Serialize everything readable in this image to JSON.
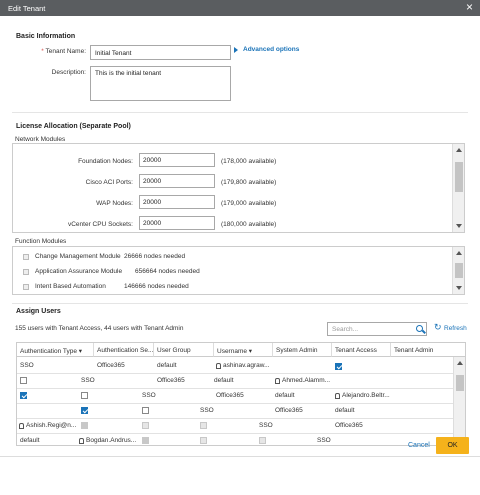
{
  "dialog": {
    "title": "Edit Tenant",
    "close_glyph": "×"
  },
  "basic": {
    "heading": "Basic Information",
    "name_label": "Tenant Name:",
    "name_required": "*",
    "name_value": "Initial Tenant",
    "advanced_link": "Advanced options",
    "desc_label": "Description:",
    "desc_value": "This is the initial tenant"
  },
  "license": {
    "heading": "License Allocation (Separate Pool)",
    "network_modules_label": "Network Modules",
    "network_modules": [
      {
        "label": "Foundation Nodes:",
        "value": "20000",
        "available": "(178,000 available)"
      },
      {
        "label": "Cisco ACI Ports:",
        "value": "20000",
        "available": "(179,800 available)"
      },
      {
        "label": "WAP Nodes:",
        "value": "20000",
        "available": "(179,000 available)"
      },
      {
        "label": "vCenter CPU Sockets:",
        "value": "20000",
        "available": "(180,000 available)"
      }
    ],
    "function_modules_label": "Function Modules",
    "function_modules": [
      {
        "name": "Change Management Module",
        "needed": "26666 nodes needed"
      },
      {
        "name": "Application Assurance Module",
        "needed": "656664 nodes needed"
      },
      {
        "name": "Intent Based Automation",
        "needed": "146666 nodes needed"
      }
    ]
  },
  "assign": {
    "heading": "Assign Users",
    "summary": "155 users with Tenant Access, 44 users with Tenant Admin",
    "search_placeholder": "Search...",
    "refresh_label": "Refresh",
    "columns": [
      "Authentication Type",
      "Authentication Se...",
      "User Group",
      "Username",
      "System Admin",
      "Tenant Access",
      "Tenant Admin"
    ],
    "sort_glyph": "▾",
    "rows": {
      "r1": {
        "auth": "SSO",
        "server": "Office365",
        "group": "default",
        "user": "ashinav.agraw..."
      },
      "r2": {
        "auth": "SSO",
        "server": "Office365",
        "group": "default",
        "user": "Ahmed.Alamm..."
      },
      "r3": {
        "auth": "SSO",
        "server": "Office365",
        "group": "default",
        "user": "Alejandro.Beltr..."
      },
      "r4": {
        "auth": "SSO",
        "server": "Office365",
        "group": "default"
      },
      "r5": {
        "user": "Ashish.Regi@n...",
        "auth": "SSO",
        "server": "Office365"
      },
      "r6": {
        "group": "default",
        "user": "Bogdan.Andrus...",
        "auth": "SSO"
      }
    }
  },
  "footer": {
    "cancel_label": "Cancel",
    "ok_label": "OK"
  },
  "colors": {
    "titlebar": "#5a5d60",
    "link": "#1a73b8",
    "ok": "#f5b21b"
  }
}
